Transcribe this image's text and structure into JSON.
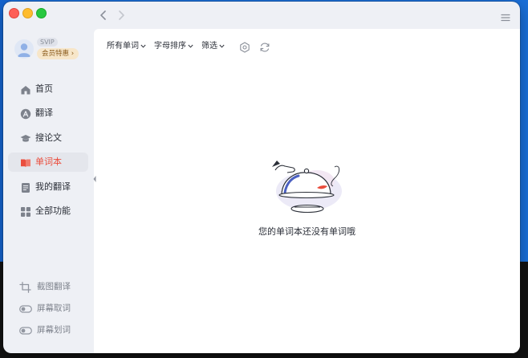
{
  "window": {
    "nav_back_icon": "chevron-left-icon",
    "nav_forward_icon": "chevron-right-icon",
    "menu_icon": "hamburger-menu-icon"
  },
  "user": {
    "badge": "SVIP",
    "vip_label": "会员特惠 ›"
  },
  "sidebar": {
    "items": [
      {
        "label": "首页",
        "icon": "home-icon"
      },
      {
        "label": "翻译",
        "icon": "translate-icon"
      },
      {
        "label": "搜论文",
        "icon": "graduation-cap-icon"
      },
      {
        "label": "单词本",
        "icon": "book-icon",
        "active": true
      },
      {
        "label": "我的翻译",
        "icon": "document-icon"
      },
      {
        "label": "全部功能",
        "icon": "grid-icon"
      }
    ],
    "tools": [
      {
        "label": "截图翻译",
        "icon": "crop-icon"
      },
      {
        "label": "屏幕取词",
        "icon": "toggle-icon"
      },
      {
        "label": "屏幕划词",
        "icon": "toggle-icon"
      }
    ]
  },
  "toolbar": {
    "filters": [
      {
        "label": "所有单词"
      },
      {
        "label": "字母排序"
      },
      {
        "label": "筛选"
      }
    ],
    "settings_icon": "settings-icon",
    "refresh_icon": "refresh-icon"
  },
  "empty_state": {
    "message": "您的单词本还没有单词哦",
    "illustration": "serving-cloche-illustration"
  },
  "colors": {
    "accent": "#ea4d3d",
    "vip_gold": "#f7e6c9",
    "sidebar_bg": "#eef0f5"
  }
}
